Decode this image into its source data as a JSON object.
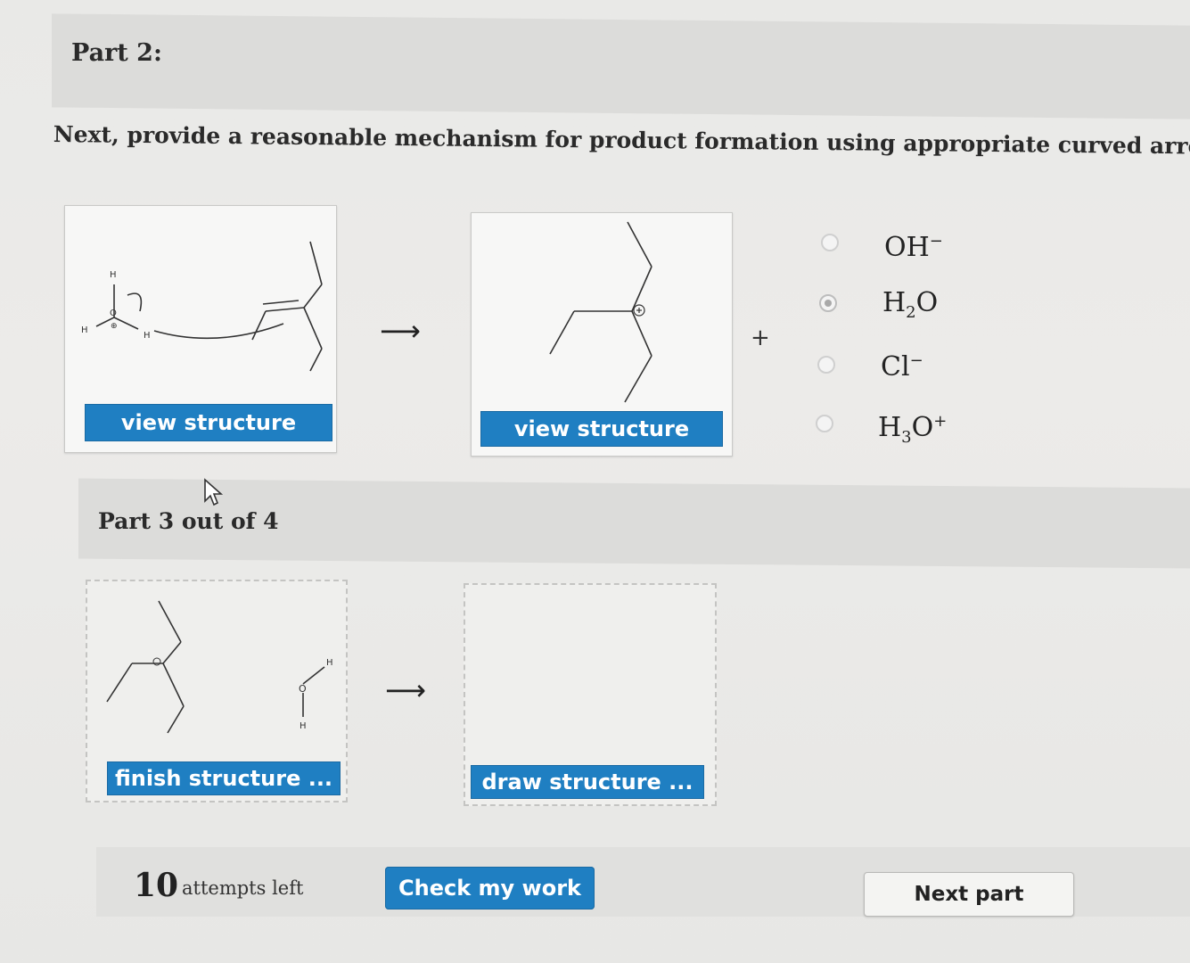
{
  "part2": {
    "title": "Part 2:",
    "instruction": "Next, provide a reasonable mechanism for product formation using appropriate curved arrow"
  },
  "part3": {
    "title": "Part 3 out of 4"
  },
  "reaction_arrow": "⟶",
  "plus_sign": "+",
  "buttons": {
    "view_structure_1": "view structure",
    "view_structure_2": "view structure",
    "finish_structure": "finish structure ...",
    "draw_structure": "draw structure ...",
    "check_my_work": "Check my work",
    "next_part": "Next part"
  },
  "byproduct_options": [
    {
      "base": "OH",
      "sub": "",
      "sup": "−",
      "selected": false
    },
    {
      "base": "H",
      "sub": "2",
      "tail": "O",
      "selected": true
    },
    {
      "base": "Cl",
      "sub": "",
      "sup": "−",
      "selected": false
    },
    {
      "base": "H",
      "sub": "3",
      "tail": "O",
      "sup": "+",
      "selected": false
    }
  ],
  "attempts": {
    "count": "10",
    "label": "attempts left"
  },
  "molecule_labels": {
    "h_atom": "H",
    "o_atom": "O",
    "plus_charge": "⊕"
  }
}
